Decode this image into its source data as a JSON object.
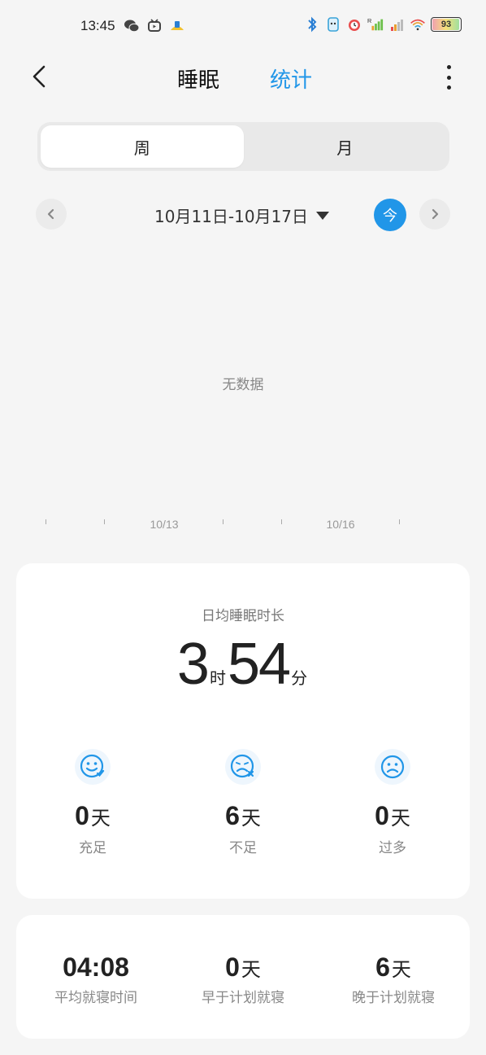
{
  "status_bar": {
    "time": "13:45",
    "battery": "93",
    "signal_label": "R"
  },
  "header": {
    "tab_sleep": "睡眠",
    "tab_stats": "统计"
  },
  "segments": {
    "week": "周",
    "month": "月",
    "selected": "week"
  },
  "date_nav": {
    "range": "10月11日-10月17日",
    "today": "今"
  },
  "chart": {
    "empty_text": "无数据",
    "tick_labels": [
      "10/13",
      "10/16"
    ]
  },
  "summary": {
    "title": "日均睡眠时长",
    "hours": "3",
    "hours_unit": "时",
    "minutes": "54",
    "minutes_unit": "分",
    "stats": [
      {
        "count": "0",
        "unit": "天",
        "label": "充足",
        "icon": "smile-check-icon"
      },
      {
        "count": "6",
        "unit": "天",
        "label": "不足",
        "icon": "frown-x-icon"
      },
      {
        "count": "0",
        "unit": "天",
        "label": "过多",
        "icon": "frown-icon"
      }
    ]
  },
  "bedtime": {
    "items": [
      {
        "value": "04:08",
        "unit": "",
        "label": "平均就寝时间"
      },
      {
        "value": "0",
        "unit": "天",
        "label": "早于计划就寝"
      },
      {
        "value": "6",
        "unit": "天",
        "label": "晚于计划就寝"
      }
    ]
  },
  "colors": {
    "accent": "#2196e8",
    "background": "#f5f5f5",
    "card": "#ffffff"
  }
}
